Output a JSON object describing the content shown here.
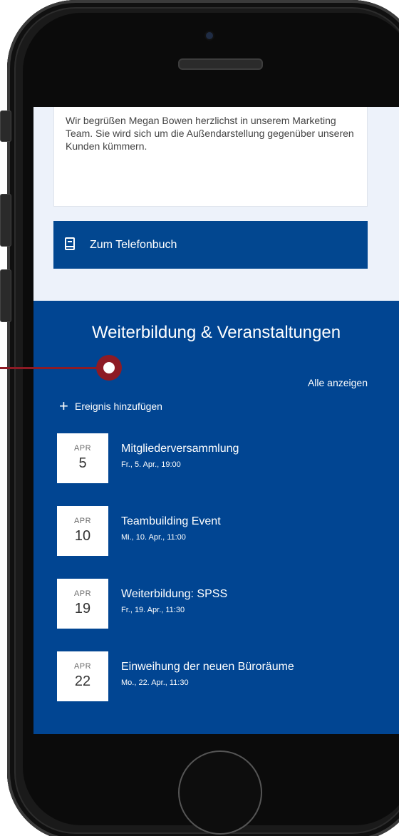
{
  "message": {
    "text": "Wir begrüßen Megan Bowen herzlichst in unserem Marketing Team. Sie wird sich um die Außendarstellung gegenüber unseren Kunden kümmern."
  },
  "phonebook": {
    "label": "Zum Telefonbuch",
    "icon": "book-icon"
  },
  "events": {
    "title": "Weiterbildung & Veranstaltungen",
    "show_all_label": "Alle anzeigen",
    "add_label": "Ereignis hinzufügen",
    "add_icon": "plus-icon",
    "items": [
      {
        "month": "APR",
        "day": "5",
        "title": "Mitgliederversammlung",
        "time": "Fr., 5. Apr., 19:00"
      },
      {
        "month": "APR",
        "day": "10",
        "title": "Teambuilding Event",
        "time": "Mi., 10. Apr., 11:00"
      },
      {
        "month": "APR",
        "day": "19",
        "title": "Weiterbildung: SPSS",
        "time": "Fr., 19. Apr., 11:30"
      },
      {
        "month": "APR",
        "day": "22",
        "title": "Einweihung der neuen Büroräume",
        "time": "Mo., 22. Apr., 11:30"
      }
    ]
  },
  "colors": {
    "brand_blue": "#014592",
    "callout": "#8d1b25",
    "screen_bg": "#edf2fa"
  }
}
